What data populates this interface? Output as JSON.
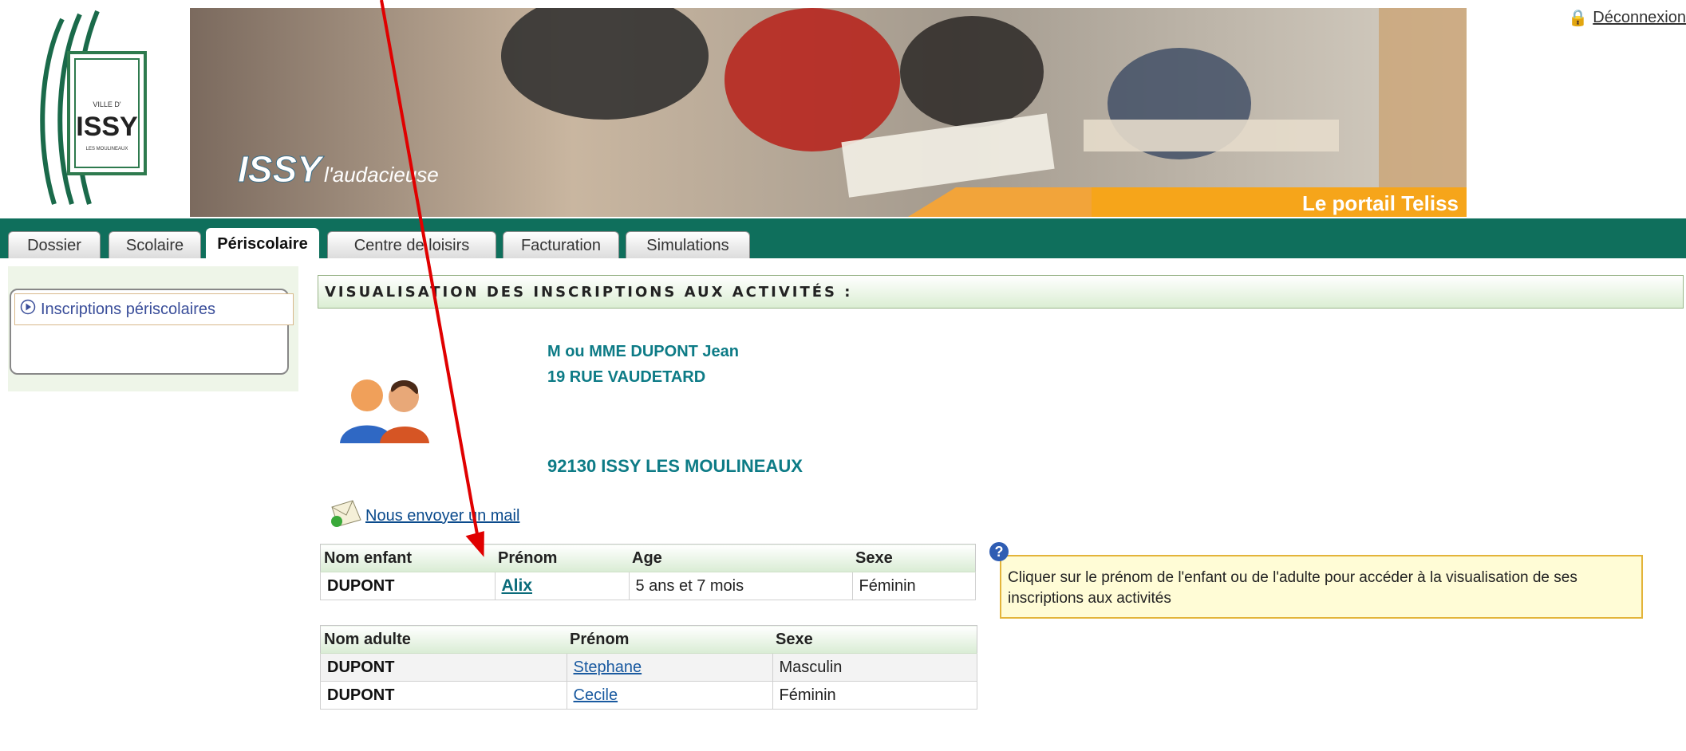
{
  "header": {
    "logo_text_small": "VILLE D'",
    "logo_text_main": "ISSY",
    "logo_text_sub": "LES MOULINEAUX",
    "banner_slogan_brand": "ISSY",
    "banner_slogan_text": "l'audacieuse",
    "banner_portal": "Le portail Teliss",
    "logout_label": "Déconnexion"
  },
  "tabs": [
    {
      "label": "Dossier"
    },
    {
      "label": "Scolaire"
    },
    {
      "label": "Périscolaire"
    },
    {
      "label": "Centre de loisirs"
    },
    {
      "label": "Facturation"
    },
    {
      "label": "Simulations"
    }
  ],
  "sidebar": {
    "item_label": "Inscriptions périscolaires"
  },
  "main": {
    "title": "VISUALISATION DES INSCRIPTIONS AUX ACTIVITÉS :",
    "parent_name": "M ou MME DUPONT Jean",
    "address_line1": "19 RUE VAUDETARD",
    "address_line2": "92130 ISSY LES MOULINEAUX",
    "mail_link": "Nous envoyer un mail"
  },
  "children_table": {
    "headers": [
      "Nom enfant",
      "Prénom",
      "Age",
      "Sexe"
    ],
    "rows": [
      {
        "nom": "DUPONT",
        "prenom": "Alix",
        "age": "5 ans et 7 mois",
        "sexe": "Féminin"
      }
    ]
  },
  "adults_table": {
    "headers": [
      "Nom adulte",
      "Prénom",
      "Sexe"
    ],
    "rows": [
      {
        "nom": "DUPONT",
        "prenom": "Stephane",
        "sexe": "Masculin"
      },
      {
        "nom": "DUPONT",
        "prenom": "Cecile",
        "sexe": "Féminin"
      }
    ]
  },
  "help": {
    "icon": "?",
    "text": "Cliquer sur le prénom de l'enfant ou de l'adulte pour accéder à la visualisation de ses inscriptions aux activités"
  },
  "colors": {
    "tab_bar": "#0f6f5c",
    "accent_teal": "#0d7b86",
    "annotation": "#e00000"
  }
}
